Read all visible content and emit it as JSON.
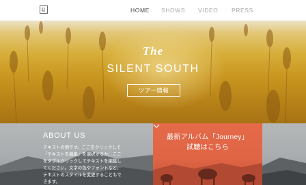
{
  "header": {
    "logo_icon": "square-logo-icon",
    "nav": [
      {
        "label": "HOME",
        "active": true
      },
      {
        "label": "SHOWS",
        "active": false
      },
      {
        "label": "VIDEO",
        "active": false
      },
      {
        "label": "PRESS",
        "active": false
      }
    ]
  },
  "hero": {
    "pre_title": "The",
    "title": "SILENT SOUTH",
    "button_label": "ツアー情報"
  },
  "about": {
    "title": "ABOUT US",
    "text": "テキストの例です。ここをクリックして「テキストを編集」を選択するか、ここをダブルクリックしてテキストを編集してください。文字の色やフォントなど、テキストのスタイルを変更することもできます。"
  },
  "album": {
    "line1": "最新アルバム「Journey」",
    "line2": "試聴はこちら",
    "chevron_icon": "chevron-down-icon"
  },
  "colors": {
    "accent": "#e0603f",
    "hero_gold": "#c9961f",
    "nav_active": "#444444",
    "nav_inactive": "#a8a8a8"
  }
}
